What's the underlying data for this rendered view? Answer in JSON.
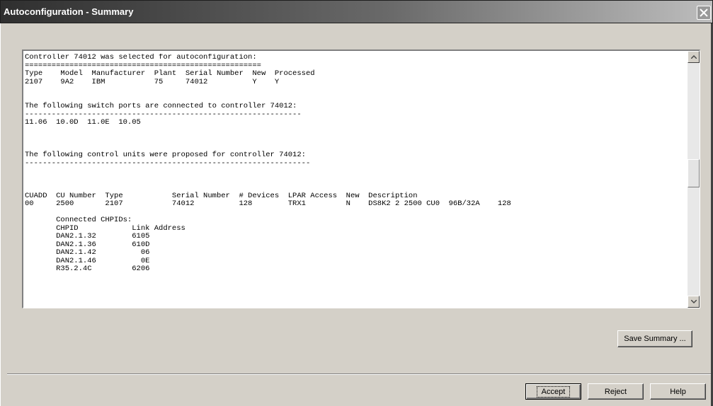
{
  "window": {
    "title": "Autoconfiguration - Summary"
  },
  "summary_lines": [
    "Controller 74012 was selected for autoconfiguration:",
    "=====================================================",
    "Type    Model  Manufacturer  Plant  Serial Number  New  Processed",
    "2107    9A2    IBM           75     74012          Y    Y",
    "",
    "",
    "The following switch ports are connected to controller 74012:",
    "--------------------------------------------------------------",
    "11.06  10.0D  11.0E  10.05",
    "",
    "",
    "",
    "The following control units were proposed for controller 74012:",
    "----------------------------------------------------------------",
    "",
    "",
    "",
    "CUADD  CU Number  Type           Serial Number  # Devices  LPAR Access  New  Description",
    "00     2500       2107           74012          128        TRX1         N    DS8K2 2 2500 CU0  96B/32A    128",
    "",
    "       Connected CHPIDs:",
    "       CHPID            Link Address",
    "       DAN2.1.32        6105",
    "       DAN2.1.36        610D",
    "       DAN2.1.42          06",
    "       DAN2.1.46          0E",
    "       R35.2.4C         6206"
  ],
  "buttons": {
    "save_summary": "Save Summary ...",
    "accept": "Accept",
    "reject": "Reject",
    "help": "Help"
  },
  "icons": {
    "close": "close-icon",
    "scroll_up": "arrow-up-icon",
    "scroll_down": "arrow-down-icon"
  }
}
